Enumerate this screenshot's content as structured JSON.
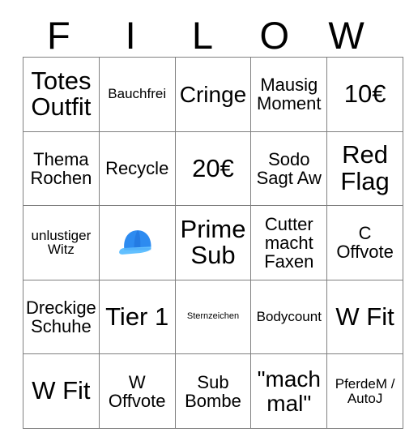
{
  "card": {
    "title": "Bingo Card",
    "header_letters": [
      "F",
      "I",
      "L",
      "O",
      "W"
    ],
    "columns": 5,
    "rows": 5,
    "border_color": "#808080",
    "text_color": "#000000",
    "background_color": "#ffffff",
    "cells": [
      [
        {
          "text": "Totes Outfit",
          "size": "fs-xl",
          "type": "text"
        },
        {
          "text": "Bauchfrei",
          "size": "fs-sm",
          "type": "text"
        },
        {
          "text": "Cringe",
          "size": "fs-lg",
          "type": "text"
        },
        {
          "text": "Mausig Moment",
          "size": "fs-md",
          "type": "text"
        },
        {
          "text": "10€",
          "size": "fs-xl",
          "type": "text"
        }
      ],
      [
        {
          "text": "Thema Rochen",
          "size": "fs-md",
          "type": "text"
        },
        {
          "text": "Recycle",
          "size": "fs-md",
          "type": "text"
        },
        {
          "text": "20€",
          "size": "fs-xl",
          "type": "text"
        },
        {
          "text": "Sodo Sagt Aw",
          "size": "fs-md",
          "type": "text"
        },
        {
          "text": "Red Flag",
          "size": "fs-xl",
          "type": "text"
        }
      ],
      [
        {
          "text": "unlustiger Witz",
          "size": "fs-sm",
          "type": "text"
        },
        {
          "text": "🧢",
          "size": "fs-emoji",
          "type": "emoji",
          "icon": "billed-cap-emoji"
        },
        {
          "text": "Prime Sub",
          "size": "fs-xl",
          "type": "text"
        },
        {
          "text": "Cutter macht Faxen",
          "size": "fs-md",
          "type": "text"
        },
        {
          "text": "C Offvote",
          "size": "fs-md",
          "type": "text"
        }
      ],
      [
        {
          "text": "Dreckige Schuhe",
          "size": "fs-md",
          "type": "text"
        },
        {
          "text": "Tier 1",
          "size": "fs-xl",
          "type": "text"
        },
        {
          "text": "Sternzeichen",
          "size": "fs-xs",
          "type": "text"
        },
        {
          "text": "Bodycount",
          "size": "fs-sm",
          "type": "text"
        },
        {
          "text": "W Fit",
          "size": "fs-xl",
          "type": "text"
        }
      ],
      [
        {
          "text": "W Fit",
          "size": "fs-xl",
          "type": "text"
        },
        {
          "text": "W Offvote",
          "size": "fs-md",
          "type": "text"
        },
        {
          "text": "Sub Bombe",
          "size": "fs-md",
          "type": "text"
        },
        {
          "text": "\"mach mal\"",
          "size": "fs-lg",
          "type": "text"
        },
        {
          "text": "PferdeM / AutoJ",
          "size": "fs-sm",
          "type": "text"
        }
      ]
    ]
  }
}
